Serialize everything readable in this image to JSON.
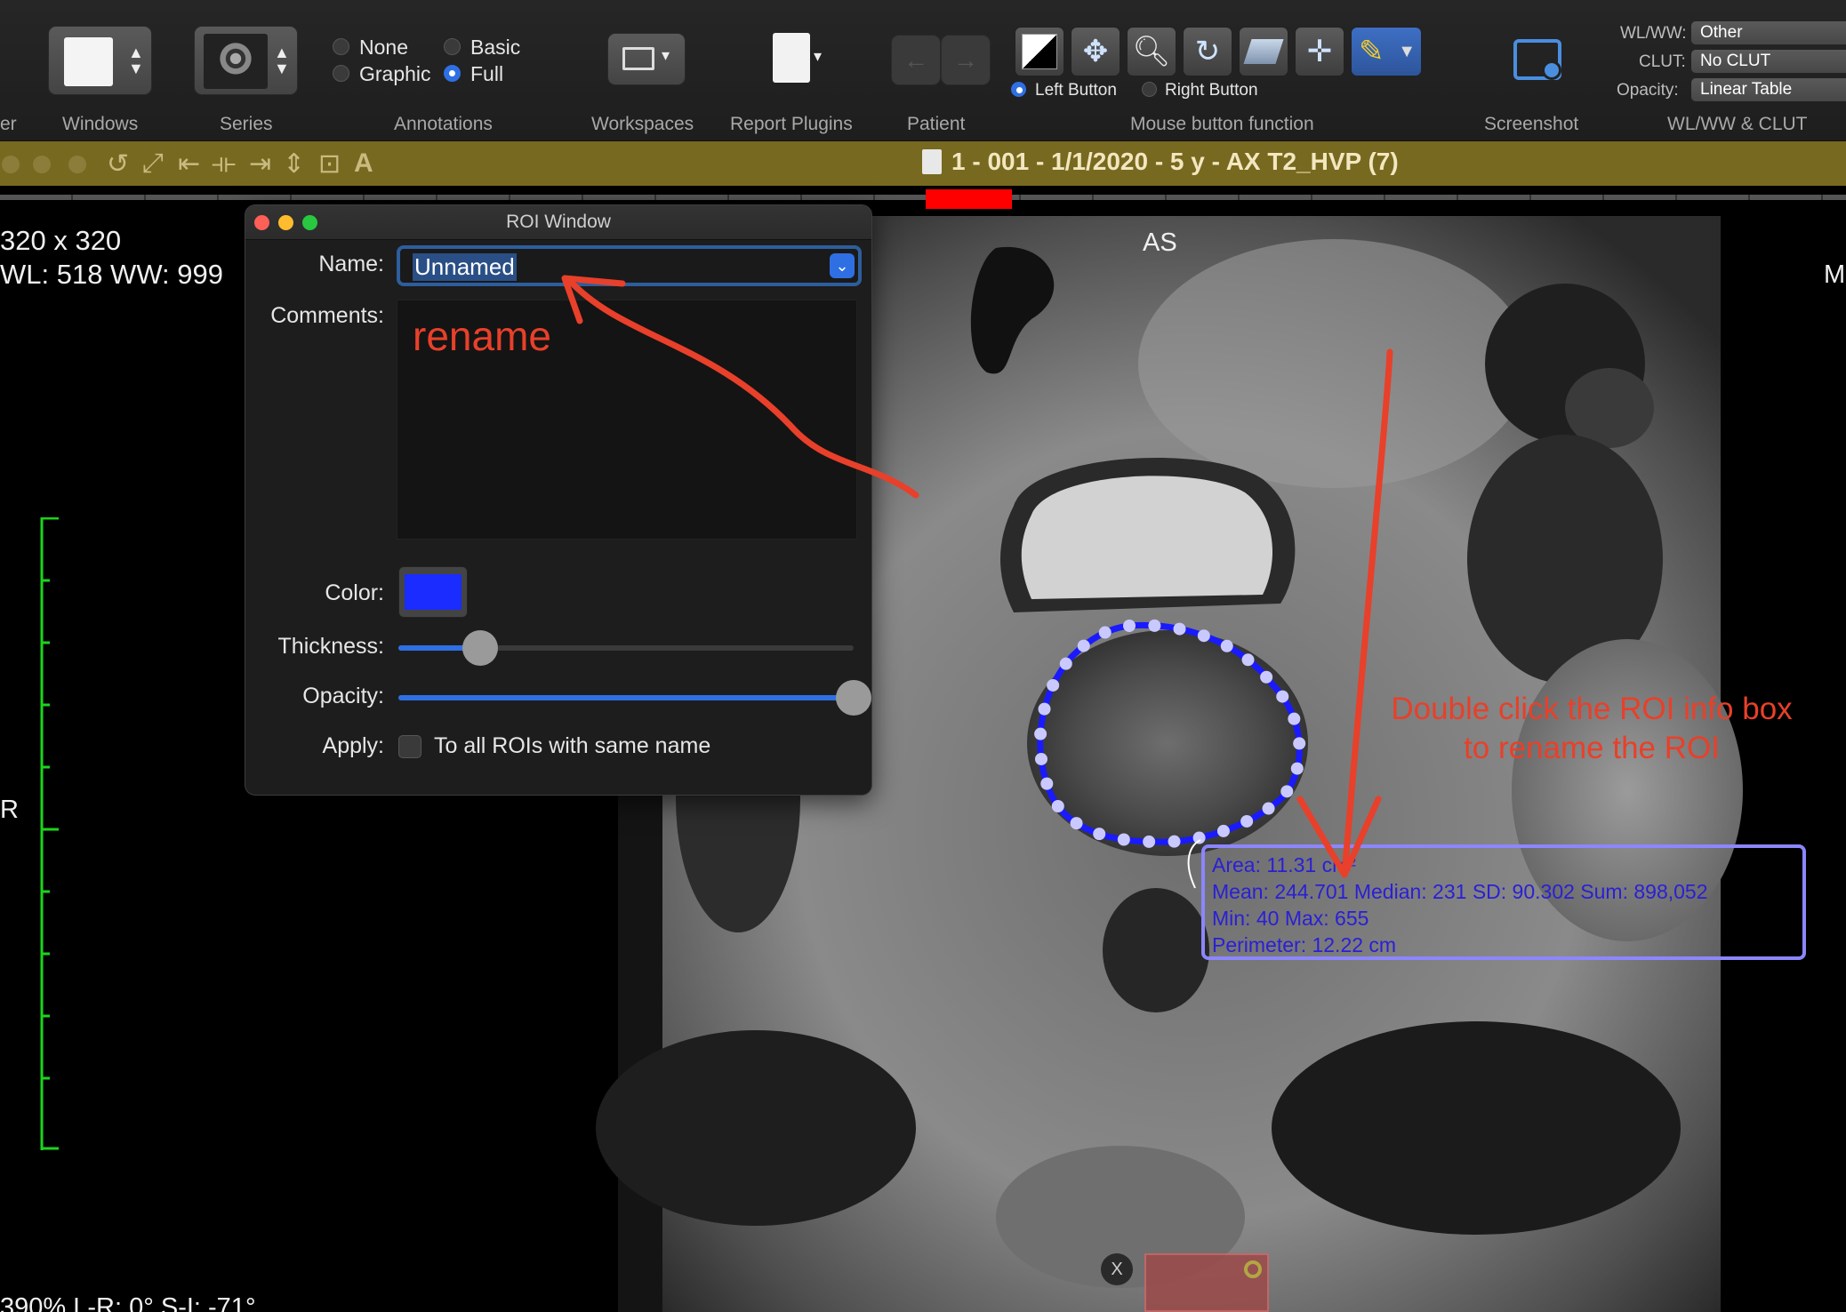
{
  "toolbar": {
    "groups": {
      "partial_left": "er",
      "windows": "Windows",
      "series": "Series",
      "annotations": "Annotations",
      "workspaces": "Workspaces",
      "report_plugins": "Report Plugins",
      "patient": "Patient",
      "mouse_function": "Mouse button function",
      "screenshot": "Screenshot",
      "wlww_clut": "WL/WW & CLUT"
    },
    "annotation_options": {
      "none": "None",
      "basic": "Basic",
      "graphic": "Graphic",
      "full": "Full",
      "selected": "Full"
    },
    "mouse_buttons": {
      "left": "Left Button",
      "right": "Right Button",
      "selected": "Left Button"
    },
    "wlww": {
      "wl_label": "WL/WW:",
      "wl_value": "Other",
      "clut_label": "CLUT:",
      "clut_value": "No CLUT",
      "opacity_label": "Opacity:",
      "opacity_value": "Linear Table"
    }
  },
  "viewer": {
    "title": "1 - 001 - 1/1/2020 - 5 y - AX T2_HVP (7)",
    "matrix": "320 x 320",
    "wlww_text": "WL: 518 WW: 999",
    "orient_top": "AS",
    "orient_right_partial": "M",
    "orient_left": "R",
    "bottom_info_partial": "390% L-R: 0° S-I: -71°",
    "close_mark": "X"
  },
  "roi_window": {
    "title": "ROI Window",
    "name_label": "Name:",
    "name_value": "Unnamed",
    "comments_label": "Comments:",
    "comments_value": "",
    "color_label": "Color:",
    "color_value": "#1a2cff",
    "thickness_label": "Thickness:",
    "thickness_level": 0.18,
    "opacity_label": "Opacity:",
    "opacity_level": 1.0,
    "apply_label": "Apply:",
    "apply_checkbox_label": "To all ROIs with same name",
    "apply_checked": false
  },
  "roi_info": {
    "line1": "Area: 11.31 cm²",
    "line2": "Mean: 244.701 Median: 231 SD: 90.302 Sum: 898,052",
    "line3": "Min: 40 Max: 655",
    "line4": "Perimeter: 12.22 cm",
    "text_color": "#2a1fd6",
    "box_color": "#8c86ff"
  },
  "annotations": {
    "rename": "rename",
    "double_click_line1": "Double click the ROI info box",
    "double_click_line2": "to rename the ROI",
    "color": "#e8402a"
  }
}
